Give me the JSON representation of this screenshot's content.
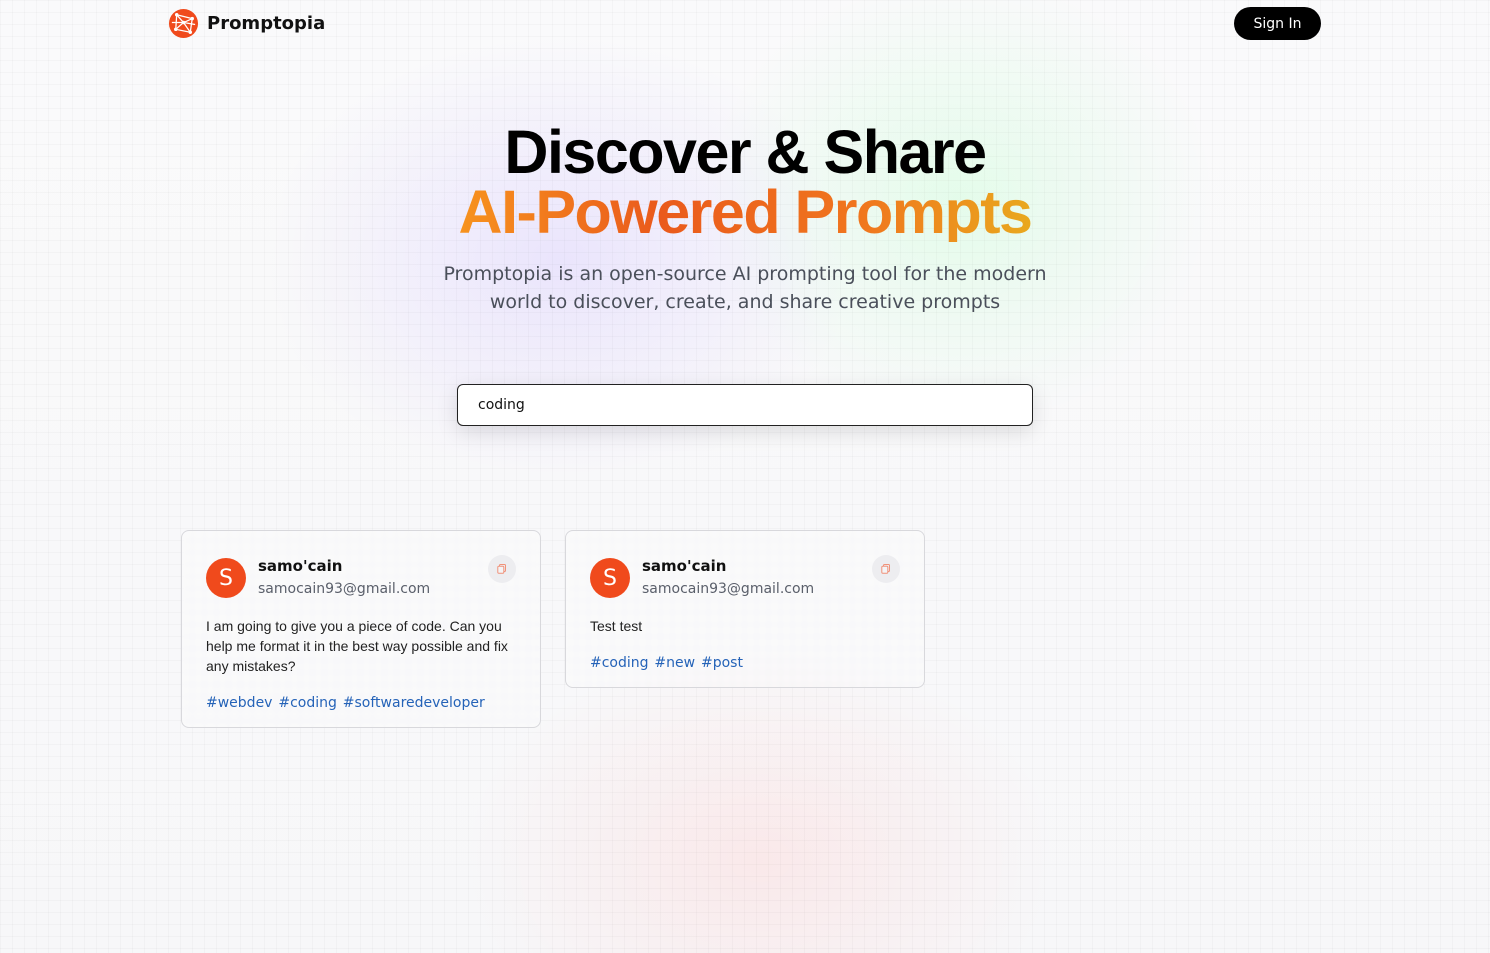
{
  "nav": {
    "brand": "Promptopia",
    "sign_in_label": "Sign In"
  },
  "hero": {
    "title_line1": "Discover & Share",
    "title_line2": "AI-Powered Prompts",
    "description": "Promptopia is an open-source AI prompting tool for the modern world to discover, create, and share creative prompts"
  },
  "search": {
    "value": "coding"
  },
  "colors": {
    "accent": "#f04a1c",
    "tag": "#2563b8",
    "gradient": [
      "#f7931e",
      "#ea5a1c",
      "#e9a81e"
    ]
  },
  "prompts": [
    {
      "avatar_letter": "S",
      "username": "samo'cain",
      "email": "samocain93@gmail.com",
      "text": "I am going to give you a piece of code. Can you help me format it in the best way possible and fix any mistakes?",
      "tags": [
        "#webdev",
        "#coding",
        "#softwaredeveloper"
      ],
      "copy_icon": "copy-icon"
    },
    {
      "avatar_letter": "S",
      "username": "samo'cain",
      "email": "samocain93@gmail.com",
      "text": "Test test",
      "tags": [
        "#coding",
        "#new",
        "#post"
      ],
      "copy_icon": "copy-icon"
    }
  ]
}
